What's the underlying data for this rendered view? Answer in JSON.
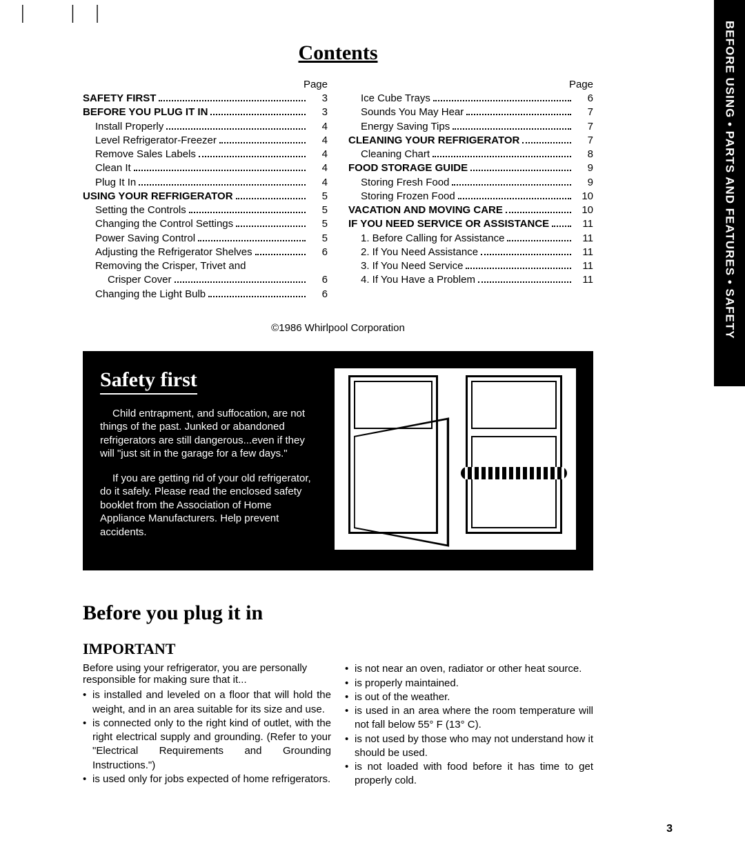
{
  "side_tab": "BEFORE USING • PARTS AND FEATURES • SAFETY",
  "contents_title": "Contents",
  "page_label": "Page",
  "toc_left": [
    {
      "label": "SAFETY FIRST",
      "page": "3",
      "bold": true,
      "indent": 0
    },
    {
      "label": "BEFORE YOU PLUG IT IN",
      "page": "3",
      "bold": true,
      "indent": 0
    },
    {
      "label": "Install Properly",
      "page": "4",
      "bold": false,
      "indent": 1
    },
    {
      "label": "Level Refrigerator-Freezer",
      "page": "4",
      "bold": false,
      "indent": 1
    },
    {
      "label": "Remove Sales Labels",
      "page": "4",
      "bold": false,
      "indent": 1
    },
    {
      "label": "Clean It",
      "page": "4",
      "bold": false,
      "indent": 1
    },
    {
      "label": "Plug It In",
      "page": "4",
      "bold": false,
      "indent": 1
    },
    {
      "label": "USING YOUR REFRIGERATOR",
      "page": "5",
      "bold": true,
      "indent": 0
    },
    {
      "label": "Setting the Controls",
      "page": "5",
      "bold": false,
      "indent": 1
    },
    {
      "label": "Changing the Control Settings",
      "page": "5",
      "bold": false,
      "indent": 1
    },
    {
      "label": "Power Saving Control",
      "page": "5",
      "bold": false,
      "indent": 1
    },
    {
      "label": "Adjusting the Refrigerator Shelves",
      "page": "6",
      "bold": false,
      "indent": 1
    },
    {
      "label": "Removing the Crisper, Trivet and",
      "page": "",
      "bold": false,
      "indent": 1,
      "nodots": true
    },
    {
      "label": "Crisper Cover",
      "page": "6",
      "bold": false,
      "indent": 2
    },
    {
      "label": "Changing the Light Bulb",
      "page": "6",
      "bold": false,
      "indent": 1
    }
  ],
  "toc_right": [
    {
      "label": "Ice Cube Trays",
      "page": "6",
      "bold": false,
      "indent": 1
    },
    {
      "label": "Sounds You May Hear",
      "page": "7",
      "bold": false,
      "indent": 1
    },
    {
      "label": "Energy Saving Tips",
      "page": "7",
      "bold": false,
      "indent": 1
    },
    {
      "label": "CLEANING YOUR REFRIGERATOR",
      "page": "7",
      "bold": true,
      "indent": 0
    },
    {
      "label": "Cleaning Chart",
      "page": "8",
      "bold": false,
      "indent": 1
    },
    {
      "label": "FOOD STORAGE GUIDE",
      "page": "9",
      "bold": true,
      "indent": 0
    },
    {
      "label": "Storing Fresh Food",
      "page": "9",
      "bold": false,
      "indent": 1
    },
    {
      "label": "Storing Frozen Food",
      "page": "10",
      "bold": false,
      "indent": 1
    },
    {
      "label": "VACATION AND MOVING CARE",
      "page": "10",
      "bold": true,
      "indent": 0
    },
    {
      "label": "IF YOU NEED SERVICE OR ASSISTANCE",
      "page": "11",
      "bold": true,
      "indent": 0
    },
    {
      "label": "1. Before Calling for Assistance",
      "page": "11",
      "bold": false,
      "indent": 1
    },
    {
      "label": "2. If You Need Assistance",
      "page": "11",
      "bold": false,
      "indent": 1
    },
    {
      "label": "3. If You Need Service",
      "page": "11",
      "bold": false,
      "indent": 1
    },
    {
      "label": "4. If You Have a Problem",
      "page": "11",
      "bold": false,
      "indent": 1
    }
  ],
  "copyright": "©1986 Whirlpool Corporation",
  "safety": {
    "title": "Safety first",
    "p1": "Child entrapment, and suffocation, are not things of the past. Junked or abandoned refrigerators are still dangerous...even if they will \"just sit in the garage for a few days.\"",
    "p2": "If you are getting rid of your old refrigerator, do it safely. Please read the enclosed safety booklet from the Association of Home Appliance Manufacturers. Help prevent accidents."
  },
  "before": {
    "title": "Before you plug it in",
    "important": "IMPORTANT",
    "intro": "Before using your refrigerator, you are personally responsible for making sure that it...",
    "left_bullets": [
      "is installed and leveled on a floor that will hold the weight, and in an area suitable for its size and use.",
      "is connected only to the right kind of outlet, with the right electrical supply and grounding. (Refer to your \"Electrical Requirements and Grounding Instructions.\")",
      "is used only for jobs expected of home refrigerators."
    ],
    "right_bullets": [
      "is not near an oven, radiator or other heat source.",
      "is properly maintained.",
      "is out of the weather.",
      "is used in an area where the room temperature will not fall below 55° F (13° C).",
      "is not used by those who may not understand how it should be used.",
      "is not loaded with food before it has time to get properly cold."
    ]
  },
  "page_number": "3"
}
